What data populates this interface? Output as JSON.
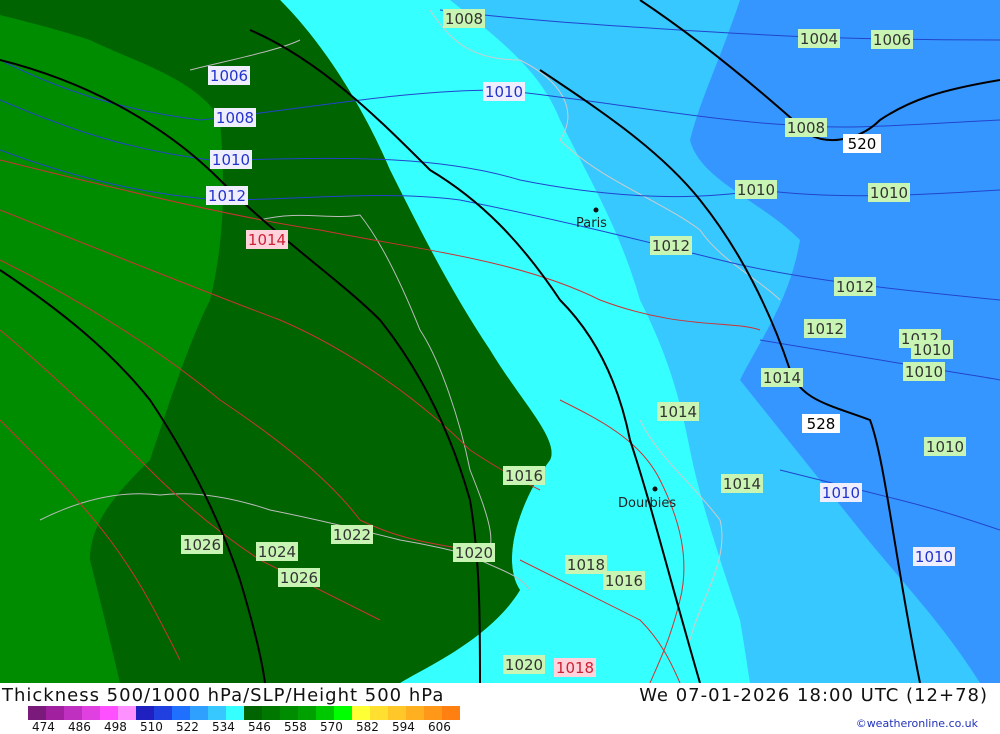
{
  "map": {
    "colors": {
      "dark_green": "#006400",
      "green": "#008c00",
      "cyan": "#36ffff",
      "light_blue": "#36c8ff",
      "blue": "#3696ff",
      "isobar_red": "#cc3333",
      "isobar_blue": "#2244cc",
      "height_black": "#000000",
      "label_bg_green": "#c8f5b4",
      "label_bg_pink": "#ffd2dc",
      "label_bg_white": "#eeeeff"
    },
    "pressure_labels": [
      {
        "text": "1008",
        "style": "green"
      },
      {
        "text": "1004",
        "style": "green"
      },
      {
        "text": "1006",
        "style": "green"
      },
      {
        "text": "1006",
        "style": "white"
      },
      {
        "text": "1010",
        "style": "white"
      },
      {
        "text": "1008",
        "style": "white"
      },
      {
        "text": "1008",
        "style": "green"
      },
      {
        "text": "1010",
        "style": "white"
      },
      {
        "text": "1012",
        "style": "white"
      },
      {
        "text": "1010",
        "style": "green"
      },
      {
        "text": "1010",
        "style": "green"
      },
      {
        "text": "1014",
        "style": "pink"
      },
      {
        "text": "1012",
        "style": "green"
      },
      {
        "text": "1012",
        "style": "green"
      },
      {
        "text": "1012",
        "style": "green"
      },
      {
        "text": "1012",
        "style": "green"
      },
      {
        "text": "1010",
        "style": "green"
      },
      {
        "text": "1010",
        "style": "green"
      },
      {
        "text": "1014",
        "style": "green"
      },
      {
        "text": "1014",
        "style": "green"
      },
      {
        "text": "1010",
        "style": "green"
      },
      {
        "text": "1014",
        "style": "green"
      },
      {
        "text": "1010",
        "style": "white"
      },
      {
        "text": "1016",
        "style": "green"
      },
      {
        "text": "1010",
        "style": "white"
      },
      {
        "text": "1026",
        "style": "green"
      },
      {
        "text": "1024",
        "style": "green"
      },
      {
        "text": "1022",
        "style": "green"
      },
      {
        "text": "1020",
        "style": "green"
      },
      {
        "text": "1018",
        "style": "green"
      },
      {
        "text": "1016",
        "style": "green"
      },
      {
        "text": "1026",
        "style": "green"
      },
      {
        "text": "1020",
        "style": "green"
      },
      {
        "text": "1018",
        "style": "pink"
      }
    ],
    "height_labels": [
      "520",
      "528"
    ],
    "cities": [
      "Paris",
      "Dourbies"
    ]
  },
  "footer": {
    "title": "Thickness 500/1000 hPa/SLP/Height 500 hPa",
    "valid": "We 07-01-2026 18:00 UTC (12+78)",
    "credit": "©weatheronline.co.uk"
  },
  "scale": {
    "colors": [
      "#7a1a7a",
      "#a020a0",
      "#c030c0",
      "#e040e0",
      "#ff50ff",
      "#ff90ff",
      "#2020c0",
      "#2040e0",
      "#2070ff",
      "#30a0ff",
      "#36c8ff",
      "#36ffff",
      "#006400",
      "#007800",
      "#008c00",
      "#00a000",
      "#00c800",
      "#00ff00",
      "#ffff36",
      "#ffe030",
      "#ffc828",
      "#ffb020",
      "#ff9818",
      "#ff8010"
    ],
    "ticks": [
      "474",
      "486",
      "498",
      "510",
      "522",
      "534",
      "546",
      "558",
      "570",
      "582",
      "594",
      "606"
    ]
  }
}
